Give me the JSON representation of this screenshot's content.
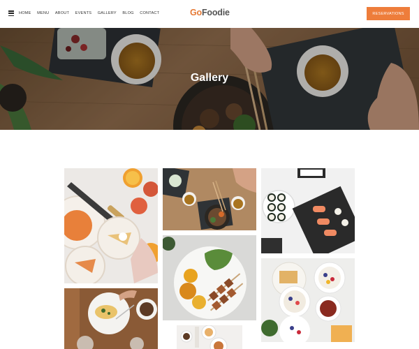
{
  "header": {
    "menu_icon": "hamburger-icon",
    "nav": [
      "HOME",
      "MENU",
      "ABOUT",
      "EVENTS",
      "GALLERY",
      "BLOG",
      "CONTACT"
    ],
    "logo_prefix": "Go",
    "logo_suffix": "Foodie",
    "reserve_label": "RESERVATIONS"
  },
  "hero": {
    "title": "Gallery"
  },
  "colors": {
    "accent": "#ee7d3b",
    "logo_accent": "#e67a35",
    "hero_wood": "#8a6440"
  },
  "gallery": {
    "images": [
      "citrus-tart-photo",
      "noodle-bowl-photo",
      "sushi-photo",
      "kebab-plate-photo",
      "berry-breakfast-photo",
      "pasta-table-photo",
      "small-dishes-photo"
    ]
  }
}
